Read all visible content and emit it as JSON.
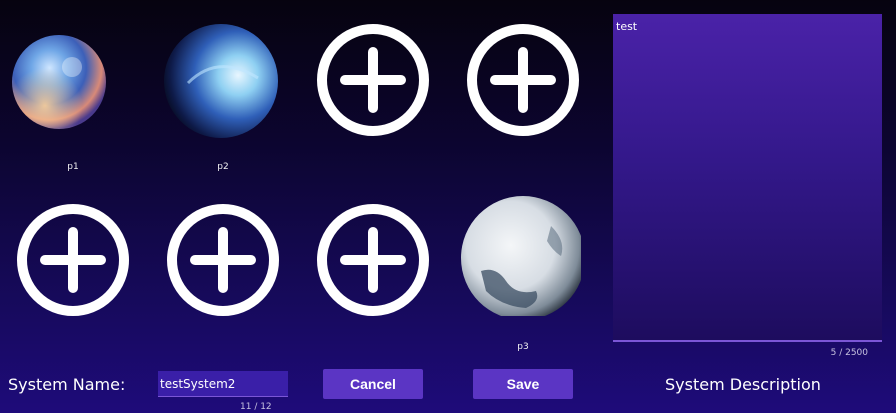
{
  "planets": [
    {
      "label": "p1",
      "icon": "nebula-planet-icon"
    },
    {
      "label": "p2",
      "icon": "blue-swirl-planet-icon"
    },
    {
      "label": "",
      "icon": "add-circle-icon"
    },
    {
      "label": "",
      "icon": "add-circle-icon"
    },
    {
      "label": "",
      "icon": "add-circle-icon"
    },
    {
      "label": "",
      "icon": "add-circle-icon"
    },
    {
      "label": "",
      "icon": "add-circle-icon"
    },
    {
      "label": "p3",
      "icon": "ice-planet-icon"
    }
  ],
  "description": {
    "text": "test",
    "counter": "5 / 2500",
    "label": "System Description"
  },
  "system_name": {
    "label": "System Name:",
    "value": "testSystem2",
    "counter": "11 / 12"
  },
  "buttons": {
    "cancel": "Cancel",
    "save": "Save"
  },
  "colors": {
    "accent": "#5b35c4",
    "panel": "#3b1a96",
    "background": "#1e0b7a"
  }
}
